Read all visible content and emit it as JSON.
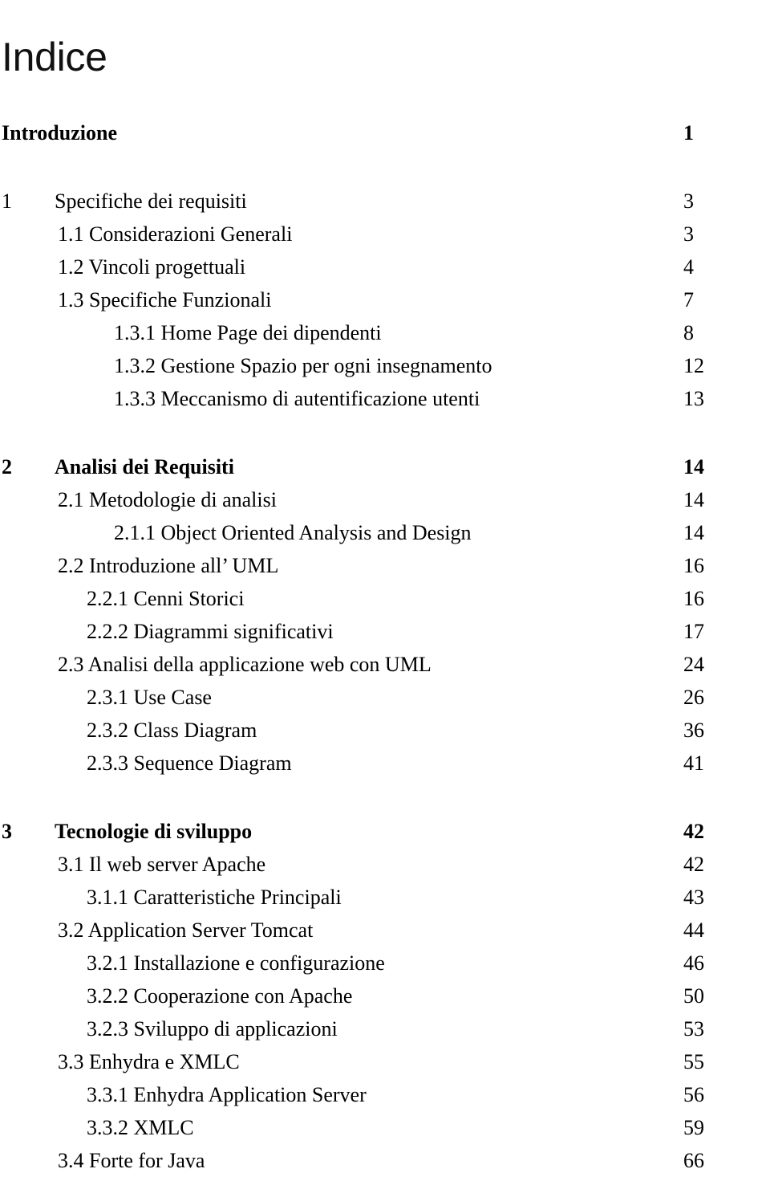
{
  "document": {
    "title": "Indice"
  },
  "toc": {
    "entries": [
      {
        "number": "",
        "label": "Introduzione",
        "page": "1",
        "level": "front",
        "bold": true,
        "space_after": "md"
      },
      {
        "number": "1",
        "label": "Specifiche dei requisiti",
        "page": "3",
        "level": "chapter",
        "bold": false,
        "space_after": "none"
      },
      {
        "number": "",
        "label": "1.1 Considerazioni Generali",
        "page": "3",
        "level": "section",
        "bold": false,
        "space_after": "none"
      },
      {
        "number": "",
        "label": "1.2 Vincoli progettuali",
        "page": "4",
        "level": "section",
        "bold": false,
        "space_after": "none"
      },
      {
        "number": "",
        "label": "1.3 Specifiche Funzionali",
        "page": "7",
        "level": "section",
        "bold": false,
        "space_after": "none"
      },
      {
        "number": "",
        "label": "1.3.1 Home Page dei dipendenti",
        "page": "8",
        "level": "subsection-deep",
        "bold": false,
        "space_after": "none"
      },
      {
        "number": "",
        "label": "1.3.2 Gestione Spazio per ogni insegnamento",
        "page": "12",
        "level": "subsection-deep",
        "bold": false,
        "space_after": "none"
      },
      {
        "number": "",
        "label": "1.3.3 Meccanismo di autentificazione utenti",
        "page": "13",
        "level": "subsection-deep",
        "bold": false,
        "space_after": "md"
      },
      {
        "number": "2",
        "label": "Analisi dei Requisiti",
        "page": "14",
        "level": "chapter",
        "bold": true,
        "space_after": "none"
      },
      {
        "number": "",
        "label": "2.1 Metodologie di analisi",
        "page": "14",
        "level": "section",
        "bold": false,
        "space_after": "none"
      },
      {
        "number": "",
        "label": "2.1.1 Object Oriented Analysis and Design",
        "page": "14",
        "level": "subsection-deep",
        "bold": false,
        "space_after": "none"
      },
      {
        "number": "",
        "label": "2.2 Introduzione all’ UML",
        "page": "16",
        "level": "section",
        "bold": false,
        "space_after": "none"
      },
      {
        "number": "",
        "label": "2.2.1 Cenni Storici",
        "page": "16",
        "level": "subsection",
        "bold": false,
        "space_after": "none"
      },
      {
        "number": "",
        "label": "2.2.2 Diagrammi significativi",
        "page": "17",
        "level": "subsection",
        "bold": false,
        "space_after": "none"
      },
      {
        "number": "",
        "label": "2.3 Analisi della applicazione web con UML",
        "page": "24",
        "level": "section",
        "bold": false,
        "space_after": "none"
      },
      {
        "number": "",
        "label": "2.3.1 Use Case",
        "page": "26",
        "level": "subsection",
        "bold": false,
        "space_after": "none"
      },
      {
        "number": "",
        "label": "2.3.2 Class Diagram",
        "page": "36",
        "level": "subsection",
        "bold": false,
        "space_after": "none"
      },
      {
        "number": "",
        "label": "2.3.3 Sequence Diagram",
        "page": "41",
        "level": "subsection",
        "bold": false,
        "space_after": "md"
      },
      {
        "number": "3",
        "label": "Tecnologie di sviluppo",
        "page": "42",
        "level": "chapter",
        "bold": true,
        "space_after": "none"
      },
      {
        "number": "",
        "label": "3.1 Il web server Apache",
        "page": "42",
        "level": "section",
        "bold": false,
        "space_after": "none"
      },
      {
        "number": "",
        "label": "3.1.1 Caratteristiche Principali",
        "page": "43",
        "level": "subsection",
        "bold": false,
        "space_after": "none"
      },
      {
        "number": "",
        "label": "3.2 Application Server Tomcat",
        "page": "44",
        "level": "section",
        "bold": false,
        "space_after": "none"
      },
      {
        "number": "",
        "label": "3.2.1 Installazione e configurazione",
        "page": "46",
        "level": "subsection",
        "bold": false,
        "space_after": "none"
      },
      {
        "number": "",
        "label": "3.2.2 Cooperazione con Apache",
        "page": "50",
        "level": "subsection",
        "bold": false,
        "space_after": "none"
      },
      {
        "number": "",
        "label": "3.2.3 Sviluppo di applicazioni",
        "page": "53",
        "level": "subsection",
        "bold": false,
        "space_after": "none"
      },
      {
        "number": "",
        "label": "3.3 Enhydra e XMLC",
        "page": "55",
        "level": "section",
        "bold": false,
        "space_after": "none"
      },
      {
        "number": "",
        "label": "3.3.1 Enhydra Application Server",
        "page": "56",
        "level": "subsection",
        "bold": false,
        "space_after": "none"
      },
      {
        "number": "",
        "label": "3.3.2   XMLC",
        "page": "59",
        "level": "subsection",
        "bold": false,
        "space_after": "none"
      },
      {
        "number": "",
        "label": "3.4 Forte for Java",
        "page": "66",
        "level": "section",
        "bold": false,
        "space_after": "none"
      }
    ]
  }
}
